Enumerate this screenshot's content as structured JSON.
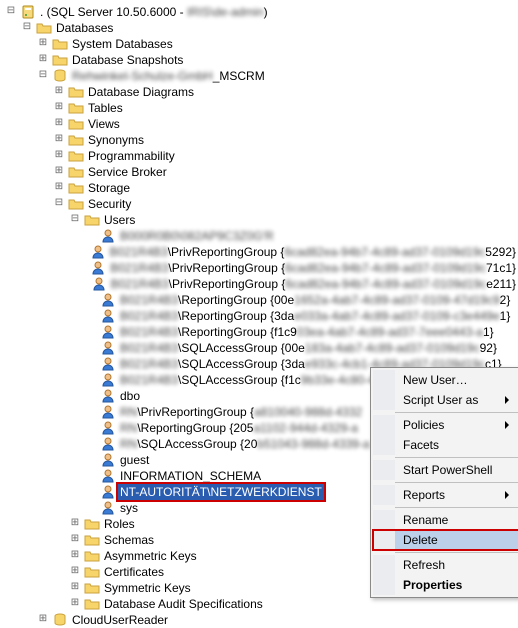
{
  "root": {
    "server": ". (SQL Server 10.50.6000 - ",
    "serverBlur": "IRIS\\de-admin",
    "serverEnd": ")"
  },
  "nodes": {
    "databases": "Databases",
    "sys_db": "System Databases",
    "snapshots": "Database Snapshots",
    "mscrm_blur": "Rehwinkel-Schulze-GmbH",
    "mscrm_suffix": "_MSCRM",
    "dbdiag": "Database Diagrams",
    "tables": "Tables",
    "views": "Views",
    "synonyms": "Synonyms",
    "programmability": "Programmability",
    "service_broker": "Service Broker",
    "storage": "Storage",
    "security": "Security",
    "users": "Users",
    "roles": "Roles",
    "schemas": "Schemas",
    "asym": "Asymmetric Keys",
    "certs": "Certificates",
    "sym": "Symmetric Keys",
    "audit": "Database Audit Specifications",
    "cloud_user_reader": "CloudUserReader"
  },
  "users": [
    {
      "blur": "B000R0B0\\082AP9C3Z0G'R",
      "suffix": ""
    },
    {
      "blur": "B021R4B3",
      "suffix": "\\PrivReportingGroup {",
      "blur2": "6cad82ea-94b7-4c89-ad37-0109d19c",
      "tail": "5292}"
    },
    {
      "blur": "B021R4B3",
      "suffix": "\\PrivReportingGroup {",
      "blur2": "6cad82ea-94b7-4c89-ad37-0109d19c",
      "tail": "71c1}"
    },
    {
      "blur": "B021R4B3",
      "suffix": "\\PrivReportingGroup {",
      "blur2": "6cad82ea-94b7-4c89-ad37-0109d19c",
      "tail": "e211}"
    },
    {
      "blur": "B021R4B3",
      "suffix": "\\ReportingGroup {00e",
      "blur2": "1652a-4ab7-4c89-ad37-0109-47d19c9",
      "tail": "2}"
    },
    {
      "blur": "B021R4B3",
      "suffix": "\\ReportingGroup {3da",
      "blur2": "e033a-4ab7-4c89-ad37-0109-c3e449e",
      "tail": "1}"
    },
    {
      "blur": "B021R4B3",
      "suffix": "\\ReportingGroup {f1c9",
      "blur2": "03ea-4ab7-4c89-ad37-7eee0443-a",
      "tail": "1}"
    },
    {
      "blur": "B021R4B3",
      "suffix": "\\SQLAccessGroup {00e",
      "blur2": "183a-4ab7-4c89-ad37-0109d19c",
      "tail": "92}"
    },
    {
      "blur": "B021R4B3",
      "suffix": "\\SQLAccessGroup {3da",
      "blur2": "e933c-4cb1-4c89-ad37-0109d19c",
      "tail": "c1}"
    },
    {
      "blur": "B021R4B3",
      "suffix": "\\SQLAccessGroup {f1c",
      "blur2": "9b33e-4c80-4c89-ad37-0109d19c0f",
      "tail": "}"
    },
    {
      "blur": "",
      "suffix": "dbo"
    },
    {
      "blur": "RN",
      "suffix": "\\PrivReportingGroup {",
      "blur2": "a810040-988d-4332",
      "tail": ""
    },
    {
      "blur": "RN",
      "suffix": "\\ReportingGroup {205",
      "blur2": "a1102-944d-4329-a",
      "tail": ""
    },
    {
      "blur": "RN",
      "suffix": "\\SQLAccessGroup {20",
      "blur2": "b51043-988d-4339-a",
      "tail": ""
    },
    {
      "blur": "",
      "suffix": "guest"
    },
    {
      "blur": "",
      "suffix": "INFORMATION_SCHEMA"
    },
    {
      "blur": "",
      "suffix": "NT-AUTORITÄT\\NETZWERKDIENST",
      "selected": true
    },
    {
      "blur": "",
      "suffix": "sys"
    }
  ],
  "menu": {
    "new_user": "New User…",
    "script_user_as": "Script User as",
    "policies": "Policies",
    "facets": "Facets",
    "start_ps": "Start PowerShell",
    "reports": "Reports",
    "rename": "Rename",
    "delete": "Delete",
    "refresh": "Refresh",
    "properties": "Properties"
  }
}
